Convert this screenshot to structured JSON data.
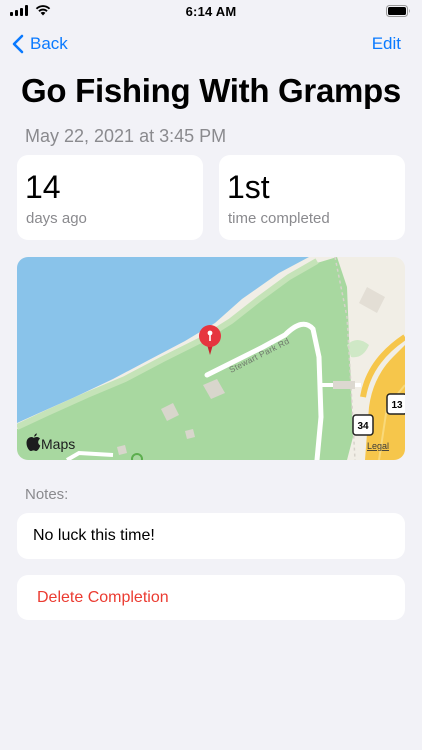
{
  "status_bar": {
    "time": "6:14 AM"
  },
  "nav": {
    "back_label": "Back",
    "edit_label": "Edit"
  },
  "title": "Go Fishing With Gramps",
  "date": "May 22, 2021 at 3:45 PM",
  "stats": [
    {
      "value": "14",
      "label": "days ago"
    },
    {
      "value": "1st",
      "label": "time completed"
    }
  ],
  "map": {
    "road_label": "Stewart Park Rd",
    "attribution": "Maps",
    "legal": "Legal",
    "route_shields": [
      "34",
      "13"
    ],
    "pin_color": "#e6353f",
    "water_color": "#89c3ea",
    "park_color": "#a8d8a0"
  },
  "notes": {
    "label": "Notes:",
    "text": "No luck this time!"
  },
  "actions": {
    "delete_label": "Delete Completion"
  },
  "colors": {
    "accent": "#0a7aff",
    "destructive": "#eb3b31",
    "background": "#f2f2f7"
  }
}
